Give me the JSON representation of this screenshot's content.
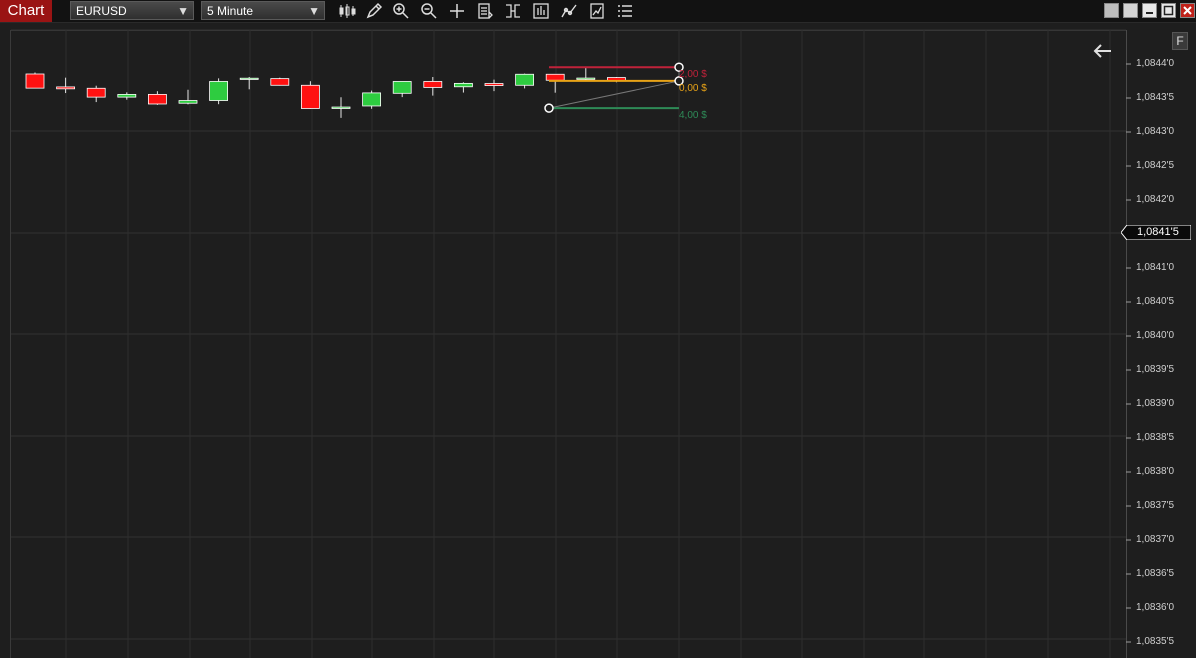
{
  "app": {
    "title": "Chart"
  },
  "toolbar": {
    "instrument": "EURUSD",
    "interval": "5 Minute",
    "tools": [
      "candlestick-icon",
      "pencil-icon",
      "zoom-in-icon",
      "zoom-out-icon",
      "crosshair-icon",
      "data-box-icon",
      "properties-icon",
      "bar-chart-icon",
      "indicator-icon",
      "strategy-icon",
      "list-icon"
    ]
  },
  "window_controls": [
    "color-square-icon",
    "color-square-icon",
    "minimize-icon",
    "maximize-icon",
    "close-icon"
  ],
  "price_axis": {
    "labels": [
      "1,0844'0",
      "1,0843'5",
      "1,0843'0",
      "1,0842'5",
      "1,0842'0",
      "1,0841'5",
      "1,0841'0",
      "1,0840'5",
      "1,0840'0",
      "1,0839'5",
      "1,0839'0",
      "1,0838'5",
      "1,0838'0",
      "1,0837'5",
      "1,0837'0",
      "1,0836'5",
      "1,0836'0",
      "1,0835'5"
    ],
    "current_price": "1,0841'5",
    "f_button": "F"
  },
  "colors": {
    "bullish": "#2ecc40",
    "bearish": "#ff1111",
    "stop": "#c0223a",
    "entry": "#e8a317",
    "target": "#2e8b57"
  },
  "chart_data": {
    "type": "candlestick",
    "instrument": "EURUSD",
    "interval": "5 Minute",
    "ylim": [
      1.08352,
      1.08445
    ],
    "candles": [
      {
        "o": 1.084253,
        "h": 1.084275,
        "l": 1.084039,
        "c": 1.084045
      },
      {
        "o": 1.084063,
        "h": 1.084199,
        "l": 1.083973,
        "c": 1.084035
      },
      {
        "o": 1.084043,
        "h": 1.084081,
        "l": 1.08384,
        "c": 1.083913
      },
      {
        "o": 1.083913,
        "h": 1.083983,
        "l": 1.083875,
        "c": 1.083953
      },
      {
        "o": 1.083953,
        "h": 1.084,
        "l": 1.083799,
        "c": 1.083812
      },
      {
        "o": 1.083823,
        "h": 1.084021,
        "l": 1.083807,
        "c": 1.083863
      },
      {
        "o": 1.083863,
        "h": 1.084189,
        "l": 1.083809,
        "c": 1.084143
      },
      {
        "o": 1.084173,
        "h": 1.084209,
        "l": 1.084028,
        "c": 1.084191
      },
      {
        "o": 1.084185,
        "h": 1.084199,
        "l": 1.084083,
        "c": 1.084087
      },
      {
        "o": 1.084087,
        "h": 1.084147,
        "l": 1.083742,
        "c": 1.083746
      },
      {
        "o": 1.083746,
        "h": 1.083911,
        "l": 1.083607,
        "c": 1.083767
      },
      {
        "o": 1.083783,
        "h": 1.084009,
        "l": 1.083741,
        "c": 1.083975
      },
      {
        "o": 1.083969,
        "h": 1.084143,
        "l": 1.083913,
        "c": 1.084143
      },
      {
        "o": 1.084143,
        "h": 1.084209,
        "l": 1.083935,
        "c": 1.084055
      },
      {
        "o": 1.084065,
        "h": 1.084131,
        "l": 1.08398,
        "c": 1.084115
      },
      {
        "o": 1.084113,
        "h": 1.084171,
        "l": 1.084001,
        "c": 1.084083
      },
      {
        "o": 1.084087,
        "h": 1.084259,
        "l": 1.084041,
        "c": 1.084249
      },
      {
        "o": 1.084249,
        "h": 1.084249,
        "l": 1.083978,
        "c": 1.084161
      },
      {
        "o": 1.084173,
        "h": 1.084353,
        "l": 1.084153,
        "c": 1.084193
      },
      {
        "o": 1.084201,
        "h": 1.084209,
        "l": 1.084131,
        "c": 1.084149
      }
    ],
    "risk_reward_tool": {
      "stop": {
        "price": 1.084353,
        "label": "2,00 $"
      },
      "entry": {
        "price": 1.084151,
        "label": "0,00 $"
      },
      "target": {
        "price": 1.083751,
        "label": "4,00 $"
      }
    }
  }
}
